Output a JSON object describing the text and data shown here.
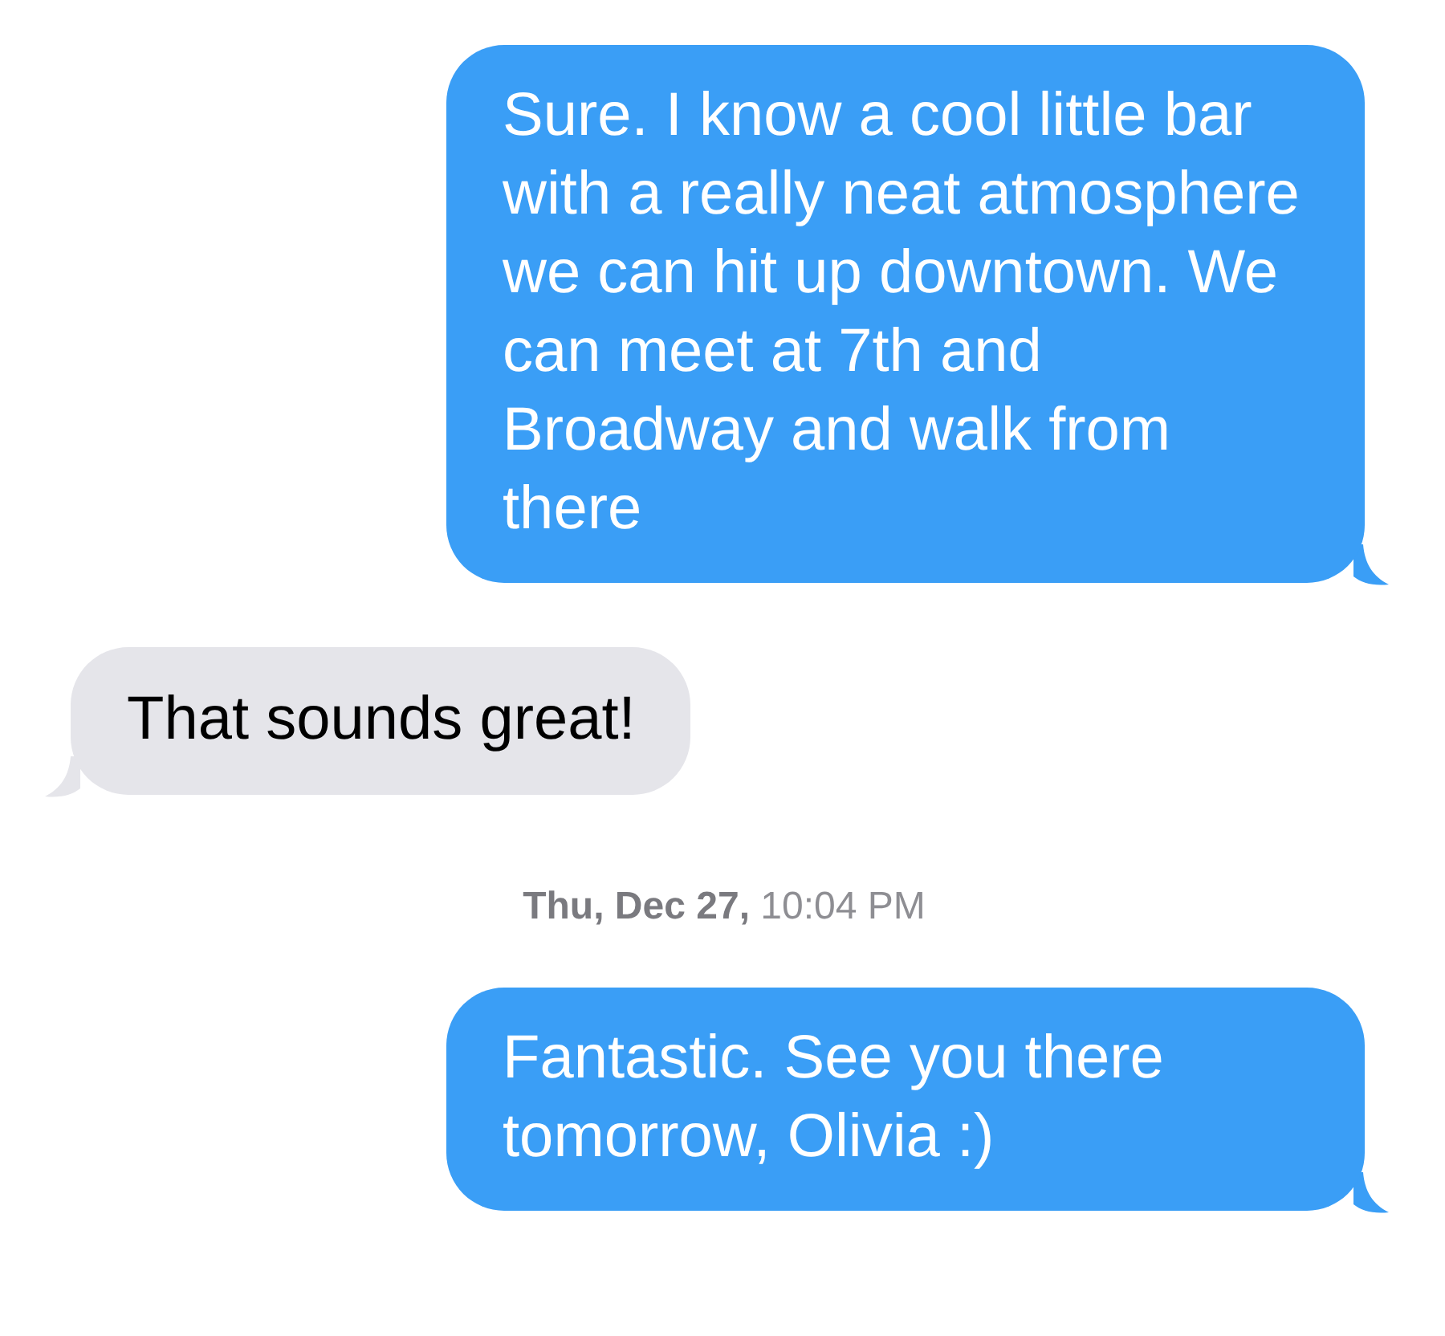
{
  "messages": [
    {
      "kind": "outgoing",
      "text": "Sure. I know a cool little bar with a really neat atmosphere we can hit up downtown. We can meet at 7th and Broadway and walk from there"
    },
    {
      "kind": "incoming",
      "text": "That sounds great!"
    },
    {
      "kind": "timestamp",
      "text": "**Thu, Dec 27,** 10:04 PM"
    },
    {
      "kind": "outgoing",
      "text": "Fantastic. See you there tomorrow, Olivia :)"
    }
  ]
}
